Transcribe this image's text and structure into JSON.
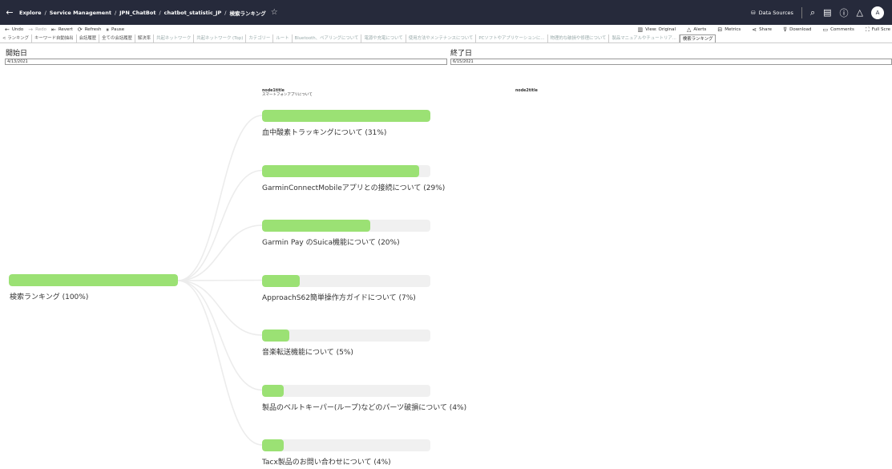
{
  "header": {
    "crumbs": [
      "Explore",
      "Service Management",
      "JPN_ChatBot",
      "chatbot_statistic_JP",
      "検索ランキング"
    ],
    "data_sources": "Data Sources",
    "avatar_initial": "A"
  },
  "toolbar": {
    "undo": "Undo",
    "redo": "Redo",
    "revert": "Revert",
    "refresh": "Refresh",
    "pause": "Pause",
    "view_original": "View: Original",
    "alerts": "Alerts",
    "metrics": "Metrics",
    "share": "Share",
    "download": "Download",
    "comments": "Comments",
    "full_screen": "Full Scre"
  },
  "tabs": [
    {
      "label": "< ランキング"
    },
    {
      "label": "キーワード自動抽出"
    },
    {
      "label": "会話履歴"
    },
    {
      "label": "全ての会話履歴"
    },
    {
      "label": "解決率"
    },
    {
      "label": "共起ネットワーク"
    },
    {
      "label": "共起ネットワーク (Top)"
    },
    {
      "label": "カテゴリー"
    },
    {
      "label": "ルート"
    },
    {
      "label": "Bluetooth、ペアリングについて"
    },
    {
      "label": "電源や充電について"
    },
    {
      "label": "使用方法やメンテナンスについて"
    },
    {
      "label": "PCソフトやアプリケーションに..."
    },
    {
      "label": "物理的な破損や修理について"
    },
    {
      "label": "製品マニュアルやチュートリア..."
    },
    {
      "label": "検索ランキング"
    }
  ],
  "filters": {
    "start_label": "開始日",
    "start_value": "4/13/2021",
    "end_label": "終了日",
    "end_value": "6/15/2021"
  },
  "tree": {
    "col1_title": "node1title",
    "col1_sub": "スマートフォンアプリについて",
    "col2_title": "node2title",
    "root": {
      "label": "検索ランキング (100%)",
      "value": 100
    },
    "children": [
      {
        "label": "血中酸素トラッキングについて (31%)",
        "value": 31
      },
      {
        "label": "GarminConnectMobileアプリとの接続について (29%)",
        "value": 29
      },
      {
        "label": "Garmin Pay のSuica機能について (20%)",
        "value": 20
      },
      {
        "label": "ApproachS62簡単操作方ガイドについて (7%)",
        "value": 7
      },
      {
        "label": "音楽転送機能について (5%)",
        "value": 5
      },
      {
        "label": "製品のベルトキーパー(ループ)などのパーツ破損について (4%)",
        "value": 4
      },
      {
        "label": "Tacx製品のお問い合わせについて (4%)",
        "value": 4
      }
    ]
  }
}
